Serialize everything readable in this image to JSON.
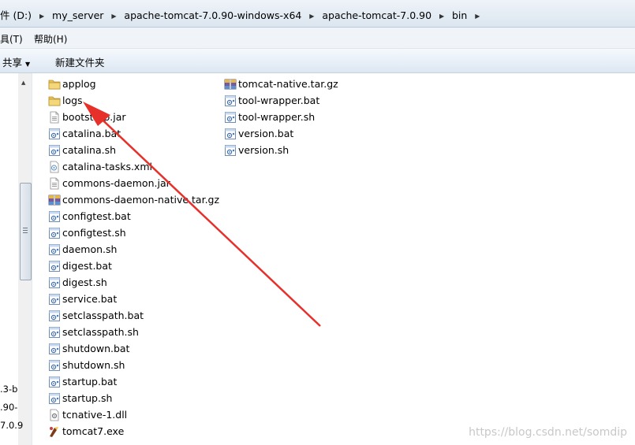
{
  "address": {
    "segments": [
      "件 (D:)",
      "my_server",
      "apache-tomcat-7.0.90-windows-x64",
      "apache-tomcat-7.0.90",
      "bin"
    ]
  },
  "menu": {
    "tools": "具(T)",
    "help": "帮助(H)"
  },
  "toolbar": {
    "share": "共享",
    "share_arrow": "▼",
    "new_folder": "新建文件夹"
  },
  "nav_fragments": [
    ".3-b",
    ".90-",
    "7.0.9"
  ],
  "files_col1": [
    {
      "name": "applog",
      "icon": "folder"
    },
    {
      "name": "logs",
      "icon": "folder"
    },
    {
      "name": "bootstrap.jar",
      "icon": "jar"
    },
    {
      "name": "catalina.bat",
      "icon": "script"
    },
    {
      "name": "catalina.sh",
      "icon": "script"
    },
    {
      "name": "catalina-tasks.xml",
      "icon": "xml"
    },
    {
      "name": "commons-daemon.jar",
      "icon": "jar"
    },
    {
      "name": "commons-daemon-native.tar.gz",
      "icon": "archive"
    },
    {
      "name": "configtest.bat",
      "icon": "script"
    },
    {
      "name": "configtest.sh",
      "icon": "script"
    },
    {
      "name": "daemon.sh",
      "icon": "script"
    },
    {
      "name": "digest.bat",
      "icon": "script"
    },
    {
      "name": "digest.sh",
      "icon": "script"
    },
    {
      "name": "service.bat",
      "icon": "script"
    },
    {
      "name": "setclasspath.bat",
      "icon": "script"
    },
    {
      "name": "setclasspath.sh",
      "icon": "script"
    },
    {
      "name": "shutdown.bat",
      "icon": "script"
    },
    {
      "name": "shutdown.sh",
      "icon": "script"
    },
    {
      "name": "startup.bat",
      "icon": "script"
    },
    {
      "name": "startup.sh",
      "icon": "script"
    },
    {
      "name": "tcnative-1.dll",
      "icon": "dll"
    },
    {
      "name": "tomcat7.exe",
      "icon": "exe"
    }
  ],
  "files_col2": [
    {
      "name": "tomcat-native.tar.gz",
      "icon": "archive"
    },
    {
      "name": "tool-wrapper.bat",
      "icon": "script"
    },
    {
      "name": "tool-wrapper.sh",
      "icon": "script"
    },
    {
      "name": "version.bat",
      "icon": "script"
    },
    {
      "name": "version.sh",
      "icon": "script"
    }
  ],
  "watermark": "https://blog.csdn.net/somdip",
  "colors": {
    "annotation_arrow": "#e8302a",
    "folder": "#e8c35a"
  }
}
